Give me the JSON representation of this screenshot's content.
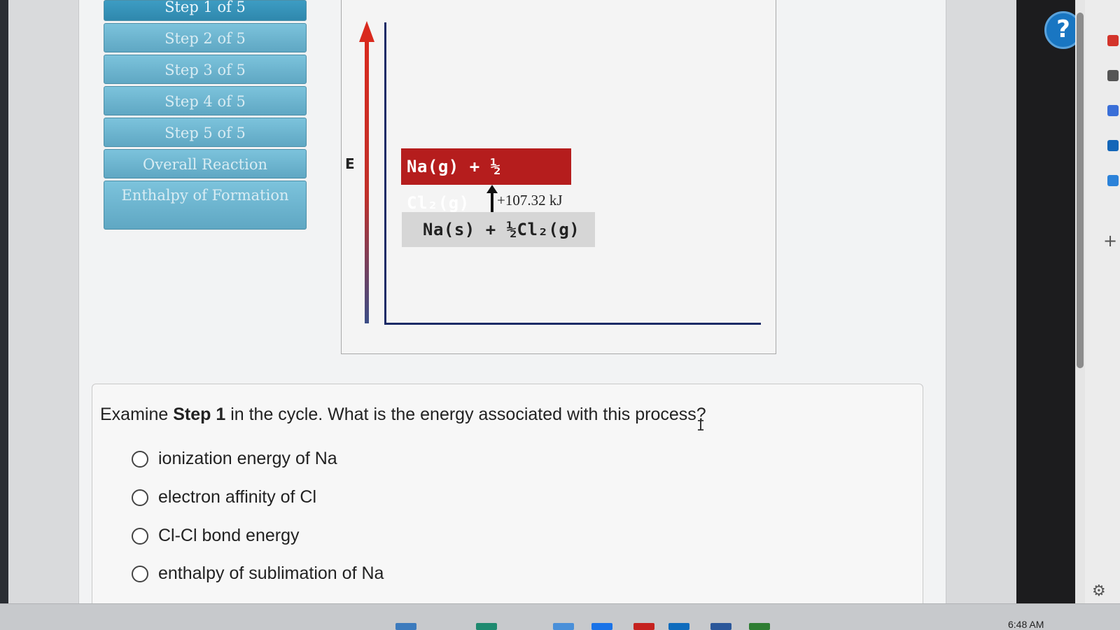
{
  "steps": [
    {
      "label": "Step 1 of 5"
    },
    {
      "label": "Step 2 of 5"
    },
    {
      "label": "Step 3 of 5"
    },
    {
      "label": "Step 4 of 5"
    },
    {
      "label": "Step 5 of 5"
    },
    {
      "label": "Overall Reaction"
    },
    {
      "label": "Enthalpy of Formation"
    }
  ],
  "diagram": {
    "axis_label": "E",
    "upper_level": "Na(g) + ½ Cl₂(g)",
    "lower_level": "Na(s) + ½Cl₂(g)",
    "delta_label": "+107.32 kJ",
    "colors": {
      "upper": "#b51d1d",
      "lower": "#d6d6d6",
      "axis": "#1b2b66"
    }
  },
  "question": {
    "prefix": "Examine ",
    "emphasis": "Step 1",
    "suffix": " in the cycle. What is the energy associated with this process?",
    "options": [
      "ionization energy of Na",
      "electron affinity of Cl",
      "Cl-Cl bond energy",
      "enthalpy of sublimation of Na"
    ]
  },
  "help": {
    "icon": "question-mark-icon",
    "label": "?"
  },
  "taskbar": {
    "time": "6:48 AM"
  }
}
